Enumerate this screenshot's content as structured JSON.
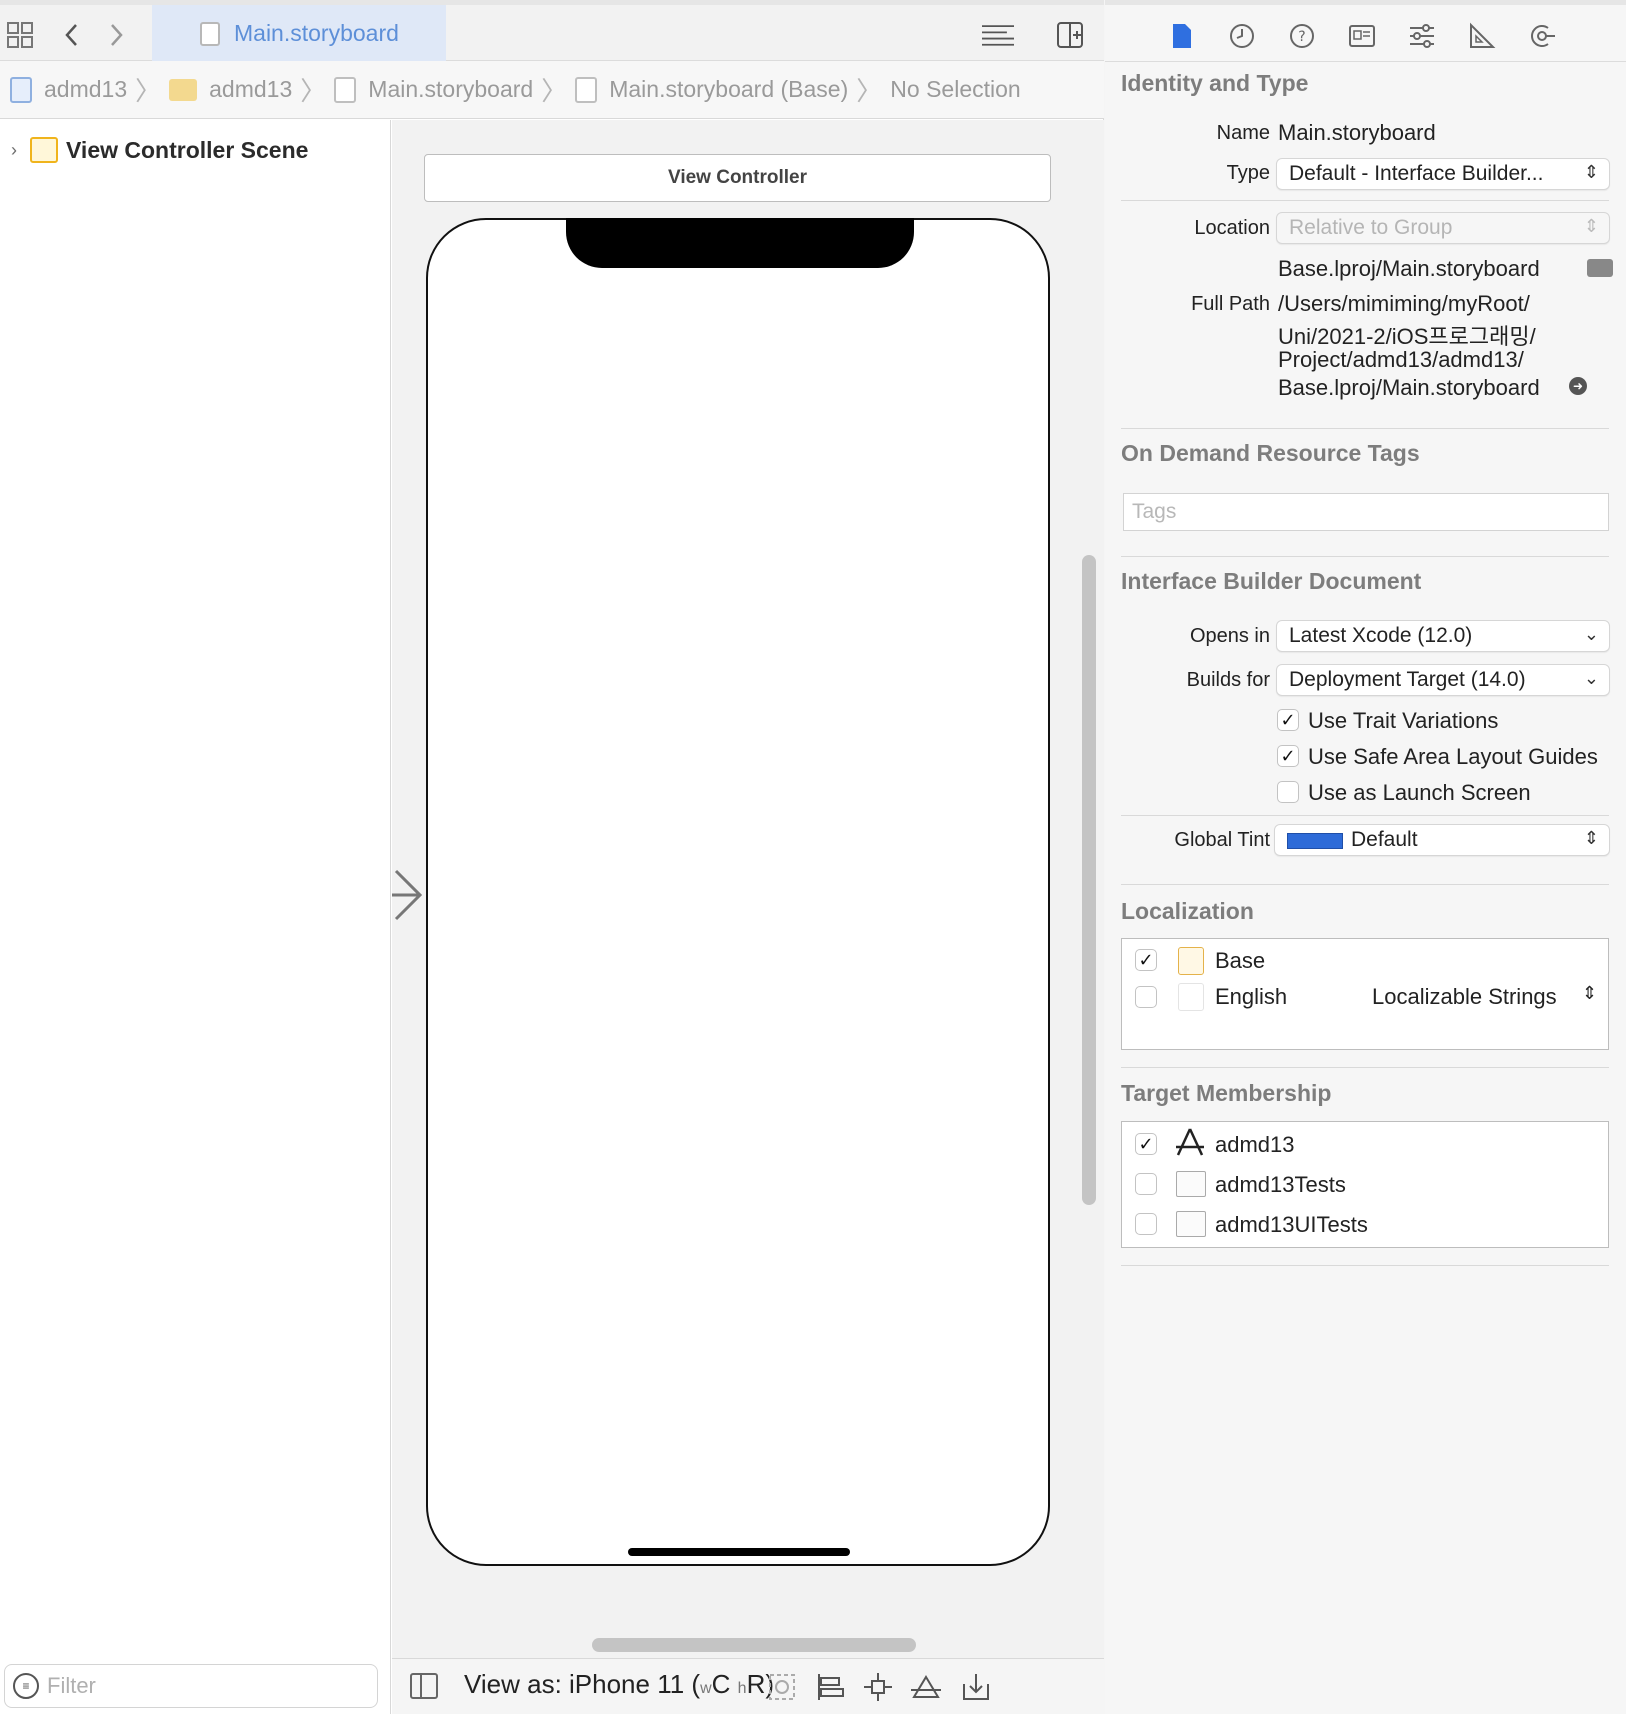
{
  "tab": {
    "title": "Main.storyboard"
  },
  "jumpbar": {
    "crumbs": [
      "admd13",
      "admd13",
      "Main.storyboard",
      "Main.storyboard (Base)"
    ],
    "selection": "No Selection"
  },
  "outline": {
    "scene": "View Controller Scene",
    "filter_placeholder": "Filter"
  },
  "canvas": {
    "scene_title": "View Controller"
  },
  "bottombar": {
    "view_as_prefix": "View as: iPhone 11 (",
    "w_small": "w",
    "w_big": "C",
    "h_small": "h",
    "h_big": "R",
    "suffix": ")"
  },
  "inspector": {
    "identity": {
      "title": "Identity and Type",
      "name_label": "Name",
      "name_value": "Main.storyboard",
      "type_label": "Type",
      "type_value": "Default - Interface Builder...",
      "location_label": "Location",
      "location_value": "Relative to Group",
      "location_path": "Base.lproj/Main.storyboard",
      "fullpath_label": "Full Path",
      "fullpath_lines": [
        "/Users/mimiming/myRoot/",
        "Uni/2021-2/iOS프로그래밍/",
        "Project/admd13/admd13/",
        "Base.lproj/Main.storyboard"
      ]
    },
    "odr": {
      "title": "On Demand Resource Tags",
      "tags_placeholder": "Tags"
    },
    "ibdoc": {
      "title": "Interface Builder Document",
      "opens_label": "Opens in",
      "opens_value": "Latest Xcode (12.0)",
      "builds_label": "Builds for",
      "builds_value": "Deployment Target (14.0)",
      "trait_label": "Use Trait Variations",
      "trait_checked": true,
      "safe_label": "Use Safe Area Layout Guides",
      "safe_checked": true,
      "launch_label": "Use as Launch Screen",
      "launch_checked": false,
      "tint_label": "Global Tint",
      "tint_value": "Default",
      "tint_color": "#2d6bd8"
    },
    "localization": {
      "title": "Localization",
      "rows": [
        {
          "name": "Base",
          "checked": true,
          "option": ""
        },
        {
          "name": "English",
          "checked": false,
          "option": "Localizable Strings"
        }
      ]
    },
    "targets": {
      "title": "Target Membership",
      "rows": [
        {
          "name": "admd13",
          "checked": true
        },
        {
          "name": "admd13Tests",
          "checked": false
        },
        {
          "name": "admd13UITests",
          "checked": false
        }
      ]
    }
  },
  "icons": {
    "check_mark": "✓",
    "popup_arrows": "⌃⌄",
    "entry_arrow": "›"
  }
}
